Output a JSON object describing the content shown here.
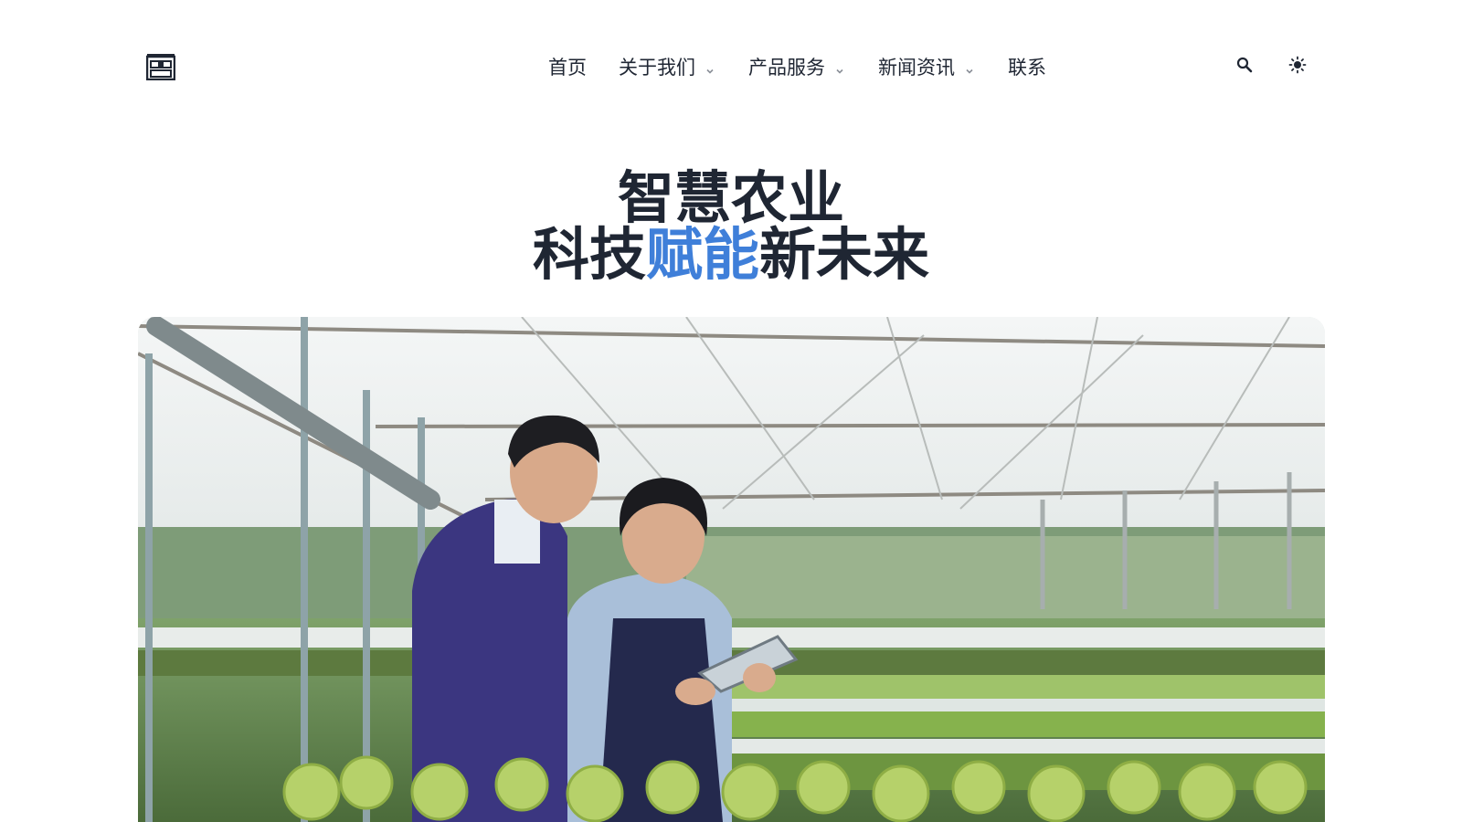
{
  "header": {
    "nav": [
      {
        "label": "首页",
        "has_dropdown": false
      },
      {
        "label": "关于我们",
        "has_dropdown": true
      },
      {
        "label": "产品服务",
        "has_dropdown": true
      },
      {
        "label": "新闻资讯",
        "has_dropdown": true
      },
      {
        "label": "联系",
        "has_dropdown": false
      }
    ],
    "icons": {
      "logo": "logo-icon",
      "search": "search-icon",
      "theme": "sun-icon"
    }
  },
  "hero": {
    "title_line1": "智慧农业",
    "title_line2_pre": "科技",
    "title_line2_accent": "赋能",
    "title_line2_post": "新未来",
    "image_alt": "greenhouse-with-two-workers"
  },
  "colors": {
    "text": "#1f2633",
    "accent": "#3f7fd9",
    "background": "#ffffff"
  }
}
